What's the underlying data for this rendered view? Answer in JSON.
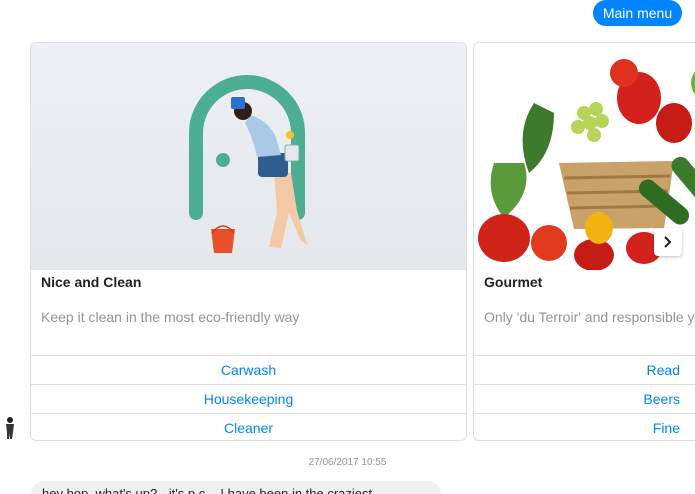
{
  "header": {
    "main_menu_label": "Main menu"
  },
  "cards": [
    {
      "title": "Nice and Clean",
      "subtitle": "Keep it clean in the most eco-friendly way",
      "buttons": [
        "Carwash",
        "Housekeeping",
        "Cleaner"
      ]
    },
    {
      "title": "Gourmet",
      "subtitle": "Only 'du Terroir' and responsible you",
      "buttons": [
        "Read",
        "Beers",
        "Fine"
      ]
    }
  ],
  "icons": {
    "next": "chevron-right-icon",
    "avatar": "user-avatar-icon"
  },
  "colors": {
    "accent": "#0084ff",
    "arch": "#4caf8f",
    "bucket": "#e8502a"
  },
  "chat": {
    "timestamp": "27/06/2017 10:55",
    "message": "hey hop, what's up? - it's p.c. - I have been in the craziest"
  }
}
